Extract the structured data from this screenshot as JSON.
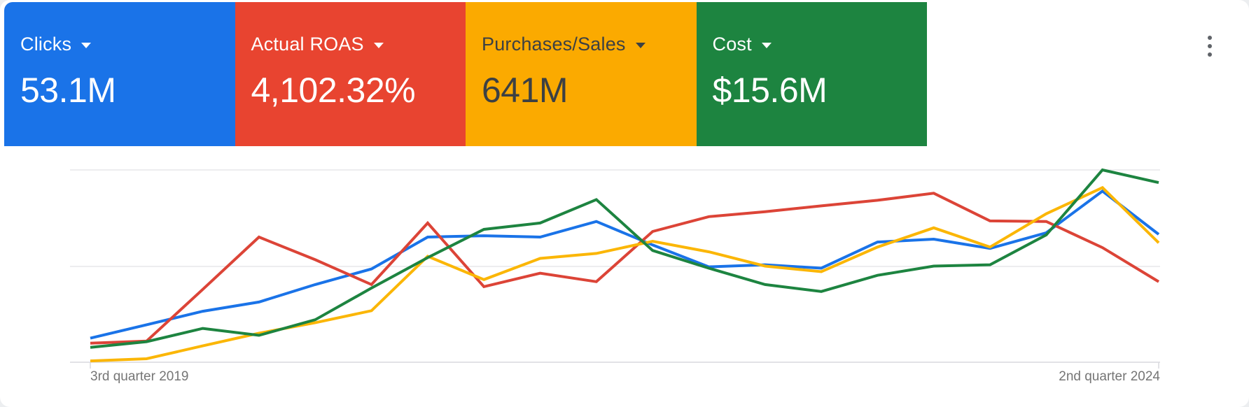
{
  "panel": {
    "type": "metrics-overview-card"
  },
  "cards": [
    {
      "label": "Clicks",
      "value": "53.1M",
      "bg": "#1a73e8",
      "text_color": "#ffffff"
    },
    {
      "label": "Actual ROAS",
      "value": "4,102.32%",
      "bg": "#e84430",
      "text_color": "#ffffff"
    },
    {
      "label": "Purchases/Sales",
      "value": "641M",
      "bg": "#fbaa00",
      "text_color": "#3c4043"
    },
    {
      "label": "Cost",
      "value": "$15.6M",
      "bg": "#1d8440",
      "text_color": "#ffffff"
    }
  ],
  "menu": {
    "icon": "kebab-menu-icon",
    "color": "#5f6368"
  },
  "chart_data": {
    "type": "line",
    "title": "",
    "xlabel": "",
    "ylabel": "",
    "x_axis": {
      "start_label": "3rd quarter 2019",
      "end_label": "2nd quarter 2024",
      "n_points": 20,
      "interval": "quarterly"
    },
    "y_axis": {
      "labels_visible": false,
      "gridline_values": [
        0,
        50,
        100
      ],
      "ylim": [
        0,
        101
      ]
    },
    "grid": {
      "horizontal": true,
      "vertical": false
    },
    "legend": "none (series colors match scorecards)",
    "series": [
      {
        "name": "Clicks",
        "color": "#1a73e8",
        "values": [
          12.5,
          19.5,
          26.5,
          31.3,
          40.4,
          48.5,
          65.1,
          65.8,
          65.1,
          73.2,
          61.0,
          49.6,
          50.7,
          48.9,
          62.5,
          64.0,
          59.2,
          67.3,
          89.0,
          66.5
        ]
      },
      {
        "name": "Actual ROAS",
        "color": "#dc4437",
        "values": [
          9.9,
          11.0,
          37.9,
          65.1,
          53.3,
          40.4,
          72.4,
          39.3,
          46.3,
          41.9,
          68.0,
          75.7,
          78.3,
          81.3,
          84.2,
          87.9,
          73.5,
          73.2,
          59.6,
          41.9
        ]
      },
      {
        "name": "Purchases/Sales",
        "color": "#fbb605",
        "values": [
          0.7,
          1.8,
          8.5,
          15.1,
          20.6,
          26.8,
          55.1,
          43.0,
          54.0,
          56.6,
          62.9,
          57.4,
          50.0,
          47.1,
          59.9,
          69.9,
          59.9,
          77.2,
          90.8,
          62.1
        ]
      },
      {
        "name": "Cost",
        "color": "#1d8440",
        "values": [
          7.7,
          10.7,
          17.6,
          14.0,
          22.1,
          38.6,
          54.4,
          69.1,
          72.4,
          84.6,
          58.1,
          48.9,
          40.4,
          36.8,
          45.2,
          50.0,
          50.7,
          66.2,
          100.0,
          93.4
        ]
      }
    ],
    "style": {
      "gridline_color": "#e7e7ea",
      "axis_color": "#d9d9de",
      "stroke_width": 4
    }
  }
}
